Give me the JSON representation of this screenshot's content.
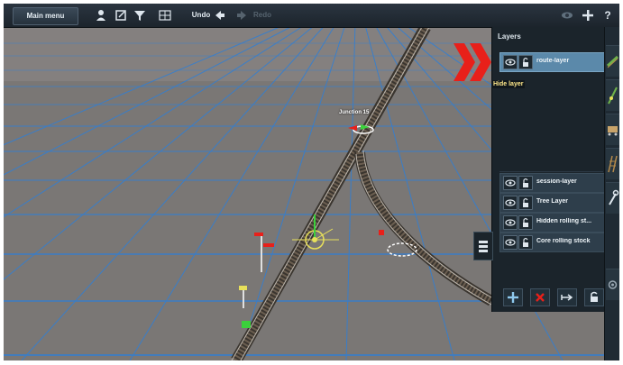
{
  "toolbar": {
    "main_menu": "Main menu",
    "undo": "Undo",
    "redo": "Redo",
    "icons": [
      "person-icon",
      "edit-icon",
      "filter-icon",
      "grid-icon",
      "undo-arrow-icon",
      "redo-arrow-icon",
      "eye-icon",
      "plus-icon",
      "help-icon"
    ]
  },
  "scene": {
    "junction_label": "Junction 15"
  },
  "layers_panel": {
    "title": "Layers",
    "tooltip": "Hide layer",
    "top_layers": [
      {
        "name": "route-layer",
        "selected": true
      }
    ],
    "bottom_layers": [
      {
        "name": "session-layer"
      },
      {
        "name": "Tree Layer"
      },
      {
        "name": "Hidden rolling st..."
      },
      {
        "name": "Core rolling stock"
      }
    ],
    "buttons": [
      "add-layer-icon",
      "delete-layer-icon",
      "merge-layer-icon",
      "lock-layer-icon"
    ]
  },
  "colors": {
    "accent_red": "#e8201a",
    "selected_row": "#5b89aa",
    "grid_line": "#2f7fd6",
    "ground": "#7a7775"
  },
  "right_rail": [
    "track-tool-icon",
    "route-edit-icon",
    "rolling-stock-icon",
    "scenery-icon",
    "tools-icon",
    "settings-icon"
  ]
}
